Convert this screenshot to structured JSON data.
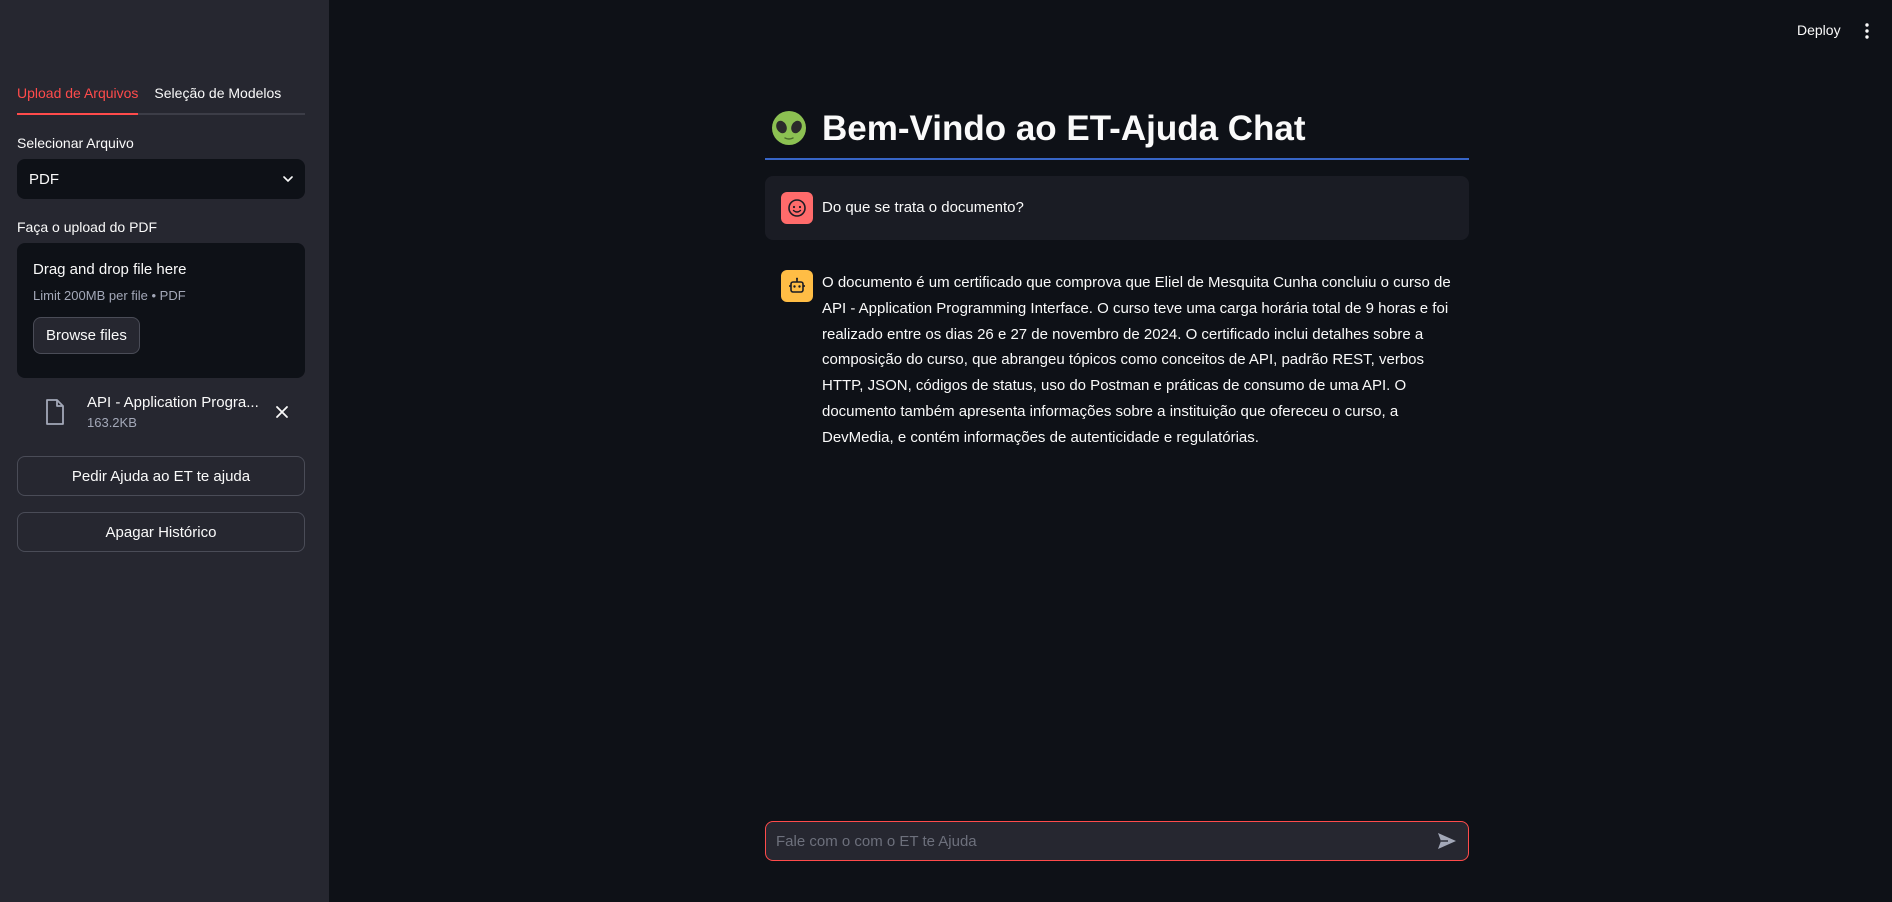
{
  "sidebar": {
    "tabs": [
      {
        "label": "Upload de Arquivos",
        "active": true
      },
      {
        "label": "Seleção de Modelos",
        "active": false
      }
    ],
    "select_label": "Selecionar Arquivo",
    "select_value": "PDF",
    "upload_label": "Faça o upload do PDF",
    "dropzone": {
      "title": "Drag and drop file here",
      "subtitle": "Limit 200MB per file • PDF",
      "browse_label": "Browse files"
    },
    "file": {
      "name": "API - Application Progra...",
      "size": "163.2KB"
    },
    "help_button": "Pedir Ajuda ao ET te ajuda",
    "clear_button": "Apagar Histórico"
  },
  "header": {
    "deploy_label": "Deploy"
  },
  "main": {
    "title": "Bem-Vindo ao ET-Ajuda Chat",
    "messages": [
      {
        "role": "user",
        "text": "Do que se trata o documento?"
      },
      {
        "role": "assistant",
        "text": "O documento é um certificado que comprova que Eliel de Mesquita Cunha concluiu o curso de API - Application Programming Interface. O curso teve uma carga horária total de 9 horas e foi realizado entre os dias 26 e 27 de novembro de 2024. O certificado inclui detalhes sobre a composição do curso, que abrangeu tópicos como conceitos de API, padrão REST, verbos HTTP, JSON, códigos de status, uso do Postman e práticas de consumo de uma API. O documento também apresenta informações sobre a instituição que ofereceu o curso, a DevMedia, e contém informações de autenticidade e regulatórias."
      }
    ],
    "input_placeholder": "Fale com o com o ET te Ajuda"
  },
  "colors": {
    "accent": "#ff4b4b",
    "sidebar_bg": "#262730",
    "main_bg": "#0e1117",
    "title_underline": "#3765c6",
    "user_avatar": "#ff6b6b",
    "bot_avatar": "#ffbd45"
  },
  "icons": {
    "title": "alien-icon",
    "user_avatar": "smiley-face-icon",
    "bot_avatar": "robot-icon",
    "file": "document-icon",
    "remove_file": "close-icon",
    "select": "chevron-down-icon",
    "menu": "kebab-menu-icon",
    "send": "send-icon"
  }
}
